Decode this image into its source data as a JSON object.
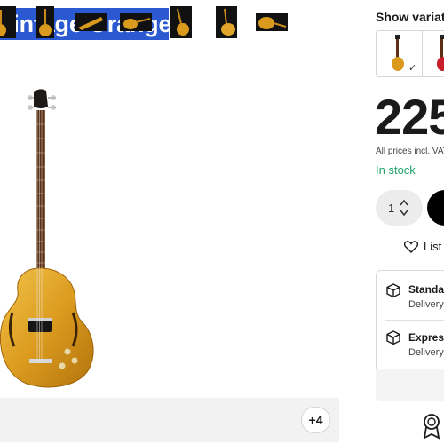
{
  "product": {
    "title": "Vintage Orange"
  },
  "gallery": {
    "more_label": "+4",
    "thumbnails": [
      "guitar-thumb-1",
      "guitar-thumb-2",
      "guitar-thumb-3",
      "guitar-thumb-4",
      "guitar-thumb-5",
      "guitar-thumb-6",
      "guitar-thumb-7"
    ]
  },
  "variations": {
    "label": "Show variatio",
    "selected_check": "✓"
  },
  "pricing": {
    "price": "225",
    "vat_note": "All prices incl. VAT",
    "stock_status": "In stock",
    "stock_color": "#1fa36b"
  },
  "purchase": {
    "quantity": "1",
    "wishlist_label": "List"
  },
  "shipping": {
    "standard_title": "Standa",
    "standard_sub": "Delivery",
    "express_title": "Express",
    "express_sub": "Delivery"
  },
  "colors": {
    "title_bg": "#2b59d1",
    "guitar_body": "#d99a1e",
    "cart_button": "#000000"
  }
}
